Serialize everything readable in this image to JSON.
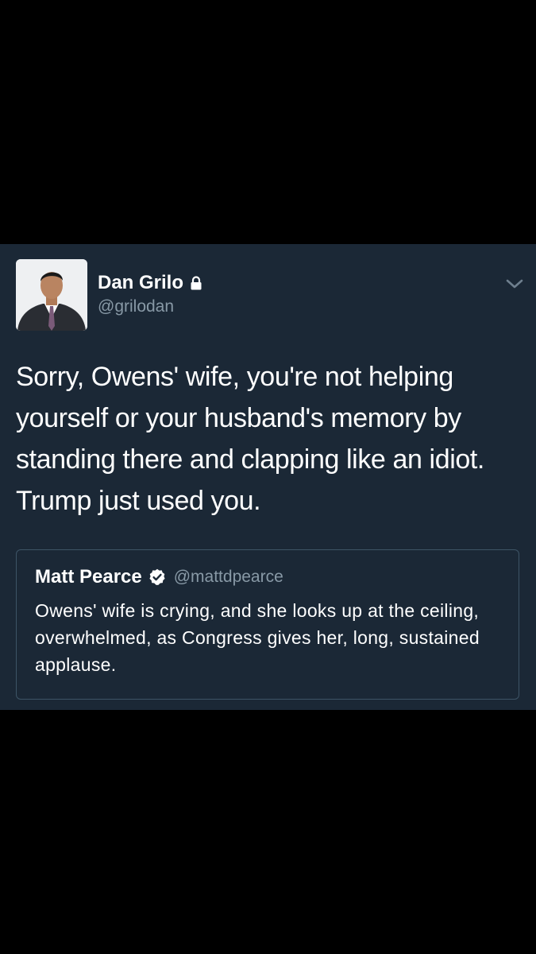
{
  "tweet": {
    "user_name": "Dan Grilo",
    "user_handle": "@grilodan",
    "text": "Sorry, Owens' wife, you're not helping\nyourself or your husband's memory by\nstanding there and clapping like an idiot.\nTrump just used you.",
    "avatar_icon": "avatar-photo",
    "lock_icon": "lock-icon",
    "menu_icon": "chevron-down-icon"
  },
  "quoted_tweet": {
    "user_name": "Matt Pearce",
    "user_handle": "@mattdpearce",
    "text": "Owens' wife is crying, and she looks up at the ceiling, overwhelmed, as Congress gives her, long, sustained applause.",
    "verified_icon": "verified-badge-icon"
  },
  "colors": {
    "page_background": "#000000",
    "card_background": "#1b2836",
    "secondary_text": "#8899a6",
    "quote_border": "#3d5466",
    "primary_text": "#ffffff"
  }
}
